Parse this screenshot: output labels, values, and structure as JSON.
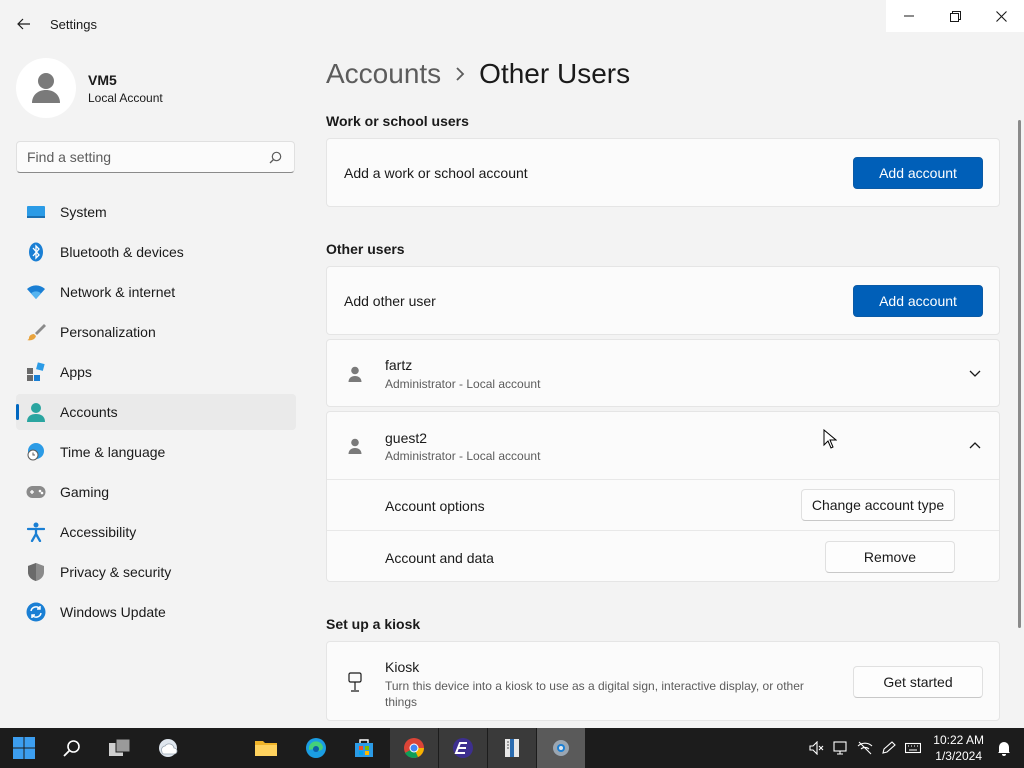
{
  "window": {
    "title": "Settings"
  },
  "profile": {
    "name": "VM5",
    "account_type": "Local Account"
  },
  "search": {
    "placeholder": "Find a setting"
  },
  "sidebar": {
    "items": [
      {
        "label": "System",
        "icon": "system-icon",
        "active": false
      },
      {
        "label": "Bluetooth & devices",
        "icon": "bluetooth-icon",
        "active": false
      },
      {
        "label": "Network & internet",
        "icon": "wifi-icon",
        "active": false
      },
      {
        "label": "Personalization",
        "icon": "brush-icon",
        "active": false
      },
      {
        "label": "Apps",
        "icon": "apps-icon",
        "active": false
      },
      {
        "label": "Accounts",
        "icon": "person-icon",
        "active": true
      },
      {
        "label": "Time & language",
        "icon": "globe-clock-icon",
        "active": false
      },
      {
        "label": "Gaming",
        "icon": "gamepad-icon",
        "active": false
      },
      {
        "label": "Accessibility",
        "icon": "accessibility-icon",
        "active": false
      },
      {
        "label": "Privacy & security",
        "icon": "shield-icon",
        "active": false
      },
      {
        "label": "Windows Update",
        "icon": "update-icon",
        "active": false
      }
    ]
  },
  "breadcrumb": {
    "parent": "Accounts",
    "current": "Other Users"
  },
  "work_school": {
    "section_title": "Work or school users",
    "row_label": "Add a work or school account",
    "button_label": "Add account"
  },
  "other_users": {
    "section_title": "Other users",
    "row_label": "Add other user",
    "button_label": "Add account",
    "users": [
      {
        "name": "fartz",
        "role": "Administrator - Local account",
        "expanded": false
      },
      {
        "name": "guest2",
        "role": "Administrator - Local account",
        "expanded": true,
        "options": {
          "account_options_label": "Account options",
          "change_type_button": "Change account type",
          "account_data_label": "Account and data",
          "remove_button": "Remove"
        }
      }
    ]
  },
  "kiosk": {
    "section_title": "Set up a kiosk",
    "title": "Kiosk",
    "description": "Turn this device into a kiosk to use as a digital sign, interactive display, or other things",
    "button_label": "Get started"
  },
  "taskbar": {
    "time": "10:22 AM",
    "date": "1/3/2024"
  },
  "colors": {
    "accent": "#005fb8",
    "background": "#f3f3f3",
    "card": "#fbfbfb",
    "taskbar": "#1c1c1c"
  }
}
